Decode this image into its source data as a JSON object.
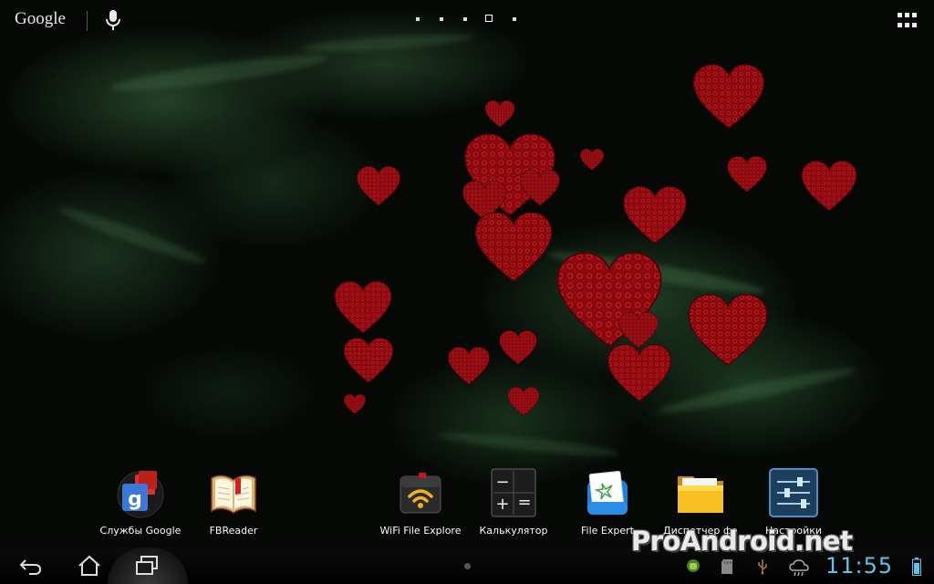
{
  "topbar": {
    "google_label": "Google",
    "mic_icon": "microphone-icon",
    "pages": 5,
    "active_page": 4,
    "apps_icon": "all-apps-grid-icon"
  },
  "dock": [
    {
      "label": "Службы Google",
      "icon": "google-services-icon"
    },
    {
      "label": "FBReader",
      "icon": "fbreader-book-icon"
    },
    {
      "label": "WiFi File Explore",
      "icon": "wifi-file-explorer-icon"
    },
    {
      "label": "Калькулятор",
      "icon": "calculator-icon"
    },
    {
      "label": "File Expert",
      "icon": "file-expert-icon"
    },
    {
      "label": "Диспетчер фа",
      "icon": "folder-icon"
    },
    {
      "label": "Настройки",
      "icon": "settings-sliders-icon"
    }
  ],
  "navbar": {
    "back_icon": "back-icon",
    "home_icon": "home-icon",
    "recents_icon": "recent-apps-icon"
  },
  "watermark": "ProAndroid.net",
  "status": {
    "clock": "11:55",
    "icons": [
      "android-notification-icon",
      "sd-card-icon",
      "usb-icon",
      "weather-icon"
    ],
    "battery_icon": "battery-icon"
  },
  "colors": {
    "clock": "#5fc2e8",
    "heart": "#c8141c",
    "fabric": "#1f4a28"
  }
}
